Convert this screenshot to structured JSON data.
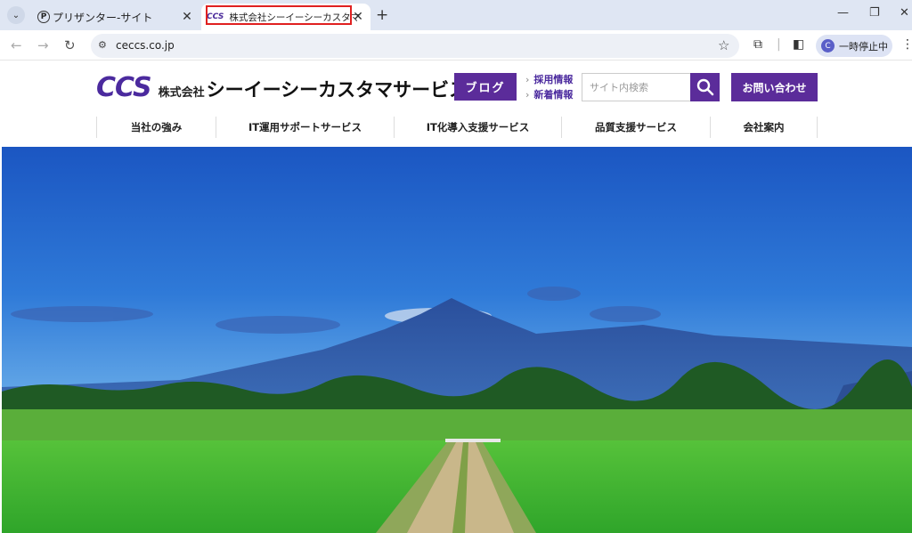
{
  "browser": {
    "tabs": [
      {
        "title": "プリザンター-サイト",
        "favicon": "P"
      },
      {
        "title": "株式会社シーイーシーカスタマサービス",
        "favicon": "CCS"
      }
    ],
    "url": "ceccs.co.jp",
    "profile_label": "一時停止中",
    "profile_initial": "C"
  },
  "site": {
    "logo_mark": "CCS",
    "logo_prefix": "株式会社",
    "logo_name": "シーイーシーカスタマサービス",
    "blog_label": "ブログ",
    "sub_links": [
      "採用情報",
      "新着情報"
    ],
    "search_placeholder": "サイト内検索",
    "contact_label": "お問い合わせ",
    "nav": [
      "当社の強み",
      "IT運用サポートサービス",
      "IT化導入支援サービス",
      "品質支援サービス",
      "会社案内"
    ]
  },
  "colors": {
    "brand": "#5b2c9a",
    "sky_top": "#1e5cc6",
    "field": "#3fb230"
  },
  "icons": {
    "search": "search-icon",
    "star": "star-icon",
    "extensions": "puzzle-icon",
    "sidepanel": "side-panel-icon"
  }
}
